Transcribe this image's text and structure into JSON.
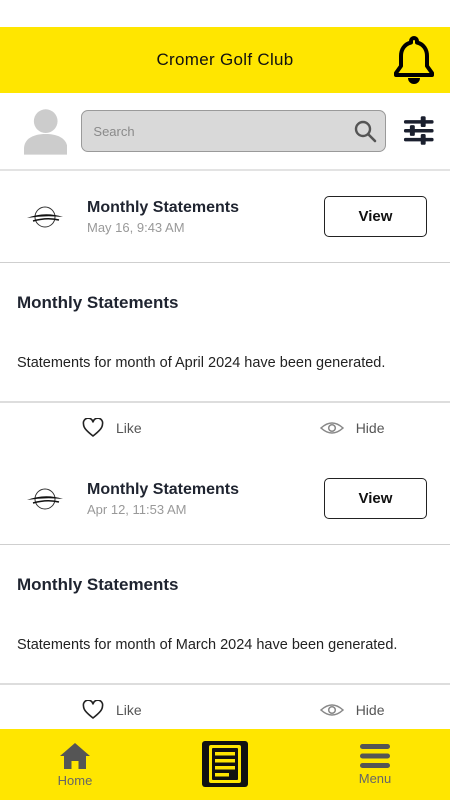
{
  "header": {
    "title": "Cromer Golf Club"
  },
  "search": {
    "placeholder": "Search"
  },
  "posts": [
    {
      "logo_text": "Cromer Golf Club",
      "title": "Monthly Statements",
      "date": "May 16, 9:43 AM",
      "view_label": "View",
      "body_title": "Monthly Statements",
      "body_text": "Statements for month of April 2024 have been generated.",
      "like_label": "Like",
      "hide_label": "Hide"
    },
    {
      "logo_text": "Cromer Golf Club",
      "title": "Monthly Statements",
      "date": "Apr 12, 11:53 AM",
      "view_label": "View",
      "body_title": "Monthly Statements",
      "body_text": "Statements for month of March 2024 have been generated.",
      "like_label": "Like",
      "hide_label": "Hide"
    }
  ],
  "tabs": [
    {
      "label": "Home",
      "icon": "home-icon"
    },
    {
      "label": "",
      "icon": "newspaper-icon"
    },
    {
      "label": "Menu",
      "icon": "menu-icon"
    }
  ],
  "colors": {
    "accent": "#ffe600",
    "dark": "#111111",
    "muted": "#666666"
  }
}
